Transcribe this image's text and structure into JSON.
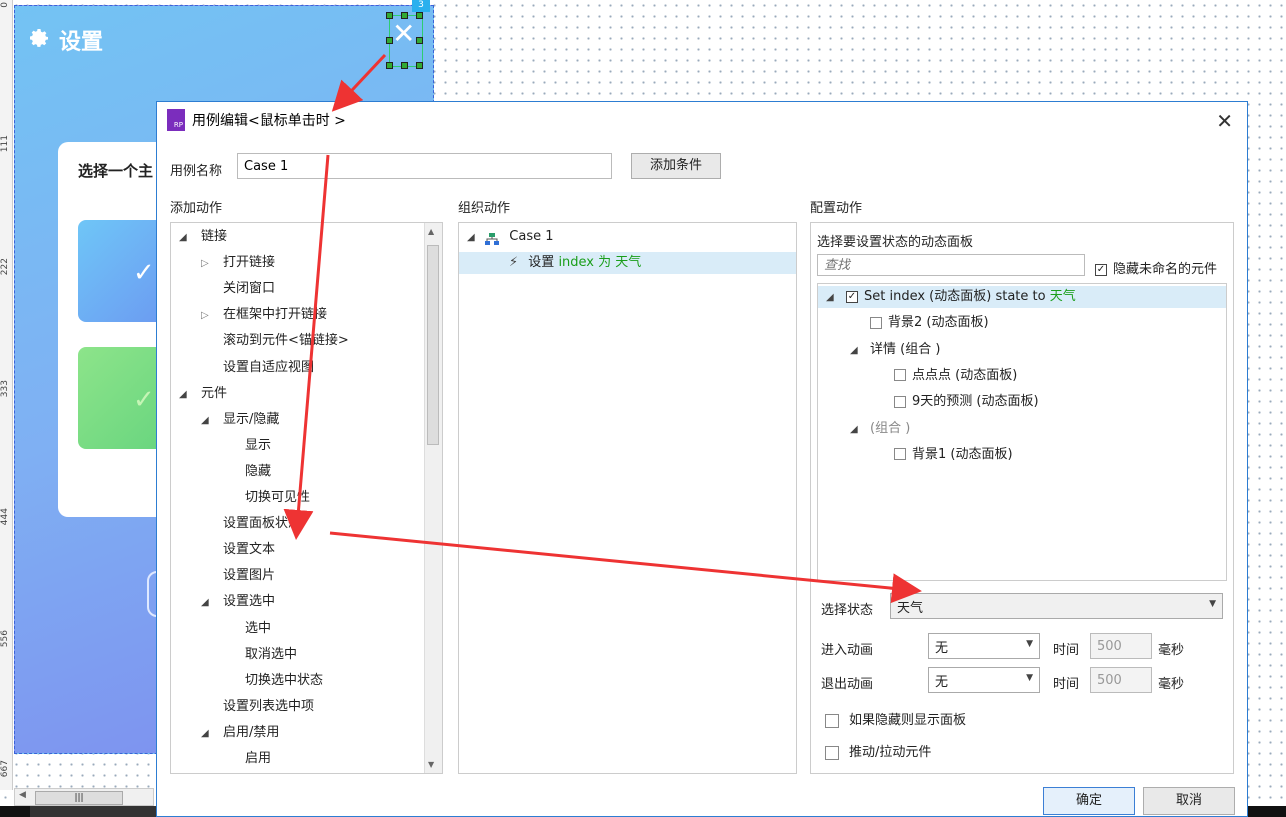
{
  "mockup": {
    "title": "设置",
    "card_title": "选择一个主",
    "badge": "3"
  },
  "ruler": [
    "0",
    "111",
    "222",
    "333",
    "444",
    "556",
    "667"
  ],
  "dialog": {
    "title": "用例编辑<鼠标单击时 >",
    "case_name_label": "用例名称",
    "case_name_value": "Case 1",
    "add_condition": "添加条件",
    "col_add": "添加动作",
    "col_org": "组织动作",
    "col_config": "配置动作",
    "add_actions": [
      {
        "label": "链接",
        "level": 0,
        "exp": "open"
      },
      {
        "label": "打开链接",
        "level": 1,
        "exp": "closed"
      },
      {
        "label": "关闭窗口",
        "level": 1,
        "exp": "none"
      },
      {
        "label": "在框架中打开链接",
        "level": 1,
        "exp": "closed"
      },
      {
        "label": "滚动到元件<锚链接>",
        "level": 1,
        "exp": "none"
      },
      {
        "label": "设置自适应视图",
        "level": 1,
        "exp": "none"
      },
      {
        "label": "元件",
        "level": 0,
        "exp": "open"
      },
      {
        "label": "显示/隐藏",
        "level": 1,
        "exp": "open"
      },
      {
        "label": "显示",
        "level": 2,
        "exp": "none"
      },
      {
        "label": "隐藏",
        "level": 2,
        "exp": "none"
      },
      {
        "label": "切换可见性",
        "level": 2,
        "exp": "none"
      },
      {
        "label": "设置面板状态",
        "level": 1,
        "exp": "none"
      },
      {
        "label": "设置文本",
        "level": 1,
        "exp": "none"
      },
      {
        "label": "设置图片",
        "level": 1,
        "exp": "none"
      },
      {
        "label": "设置选中",
        "level": 1,
        "exp": "open"
      },
      {
        "label": "选中",
        "level": 2,
        "exp": "none"
      },
      {
        "label": "取消选中",
        "level": 2,
        "exp": "none"
      },
      {
        "label": "切换选中状态",
        "level": 2,
        "exp": "none"
      },
      {
        "label": "设置列表选中项",
        "level": 1,
        "exp": "none"
      },
      {
        "label": "启用/禁用",
        "level": 1,
        "exp": "open"
      },
      {
        "label": "启用",
        "level": 2,
        "exp": "none"
      }
    ],
    "org": {
      "case": "Case 1",
      "action_prefix": "设置",
      "action_target": "index 为 天气"
    },
    "config": {
      "panel_title": "选择要设置状态的动态面板",
      "search_placeholder": "查找",
      "hide_unnamed": "隐藏未命名的元件",
      "tree": [
        {
          "pre": "Set index (动态面板) state to ",
          "hl": "天气",
          "checked": true,
          "tri": true,
          "indent": 0
        },
        {
          "pre": "背景2 (动态面板)",
          "hl": "",
          "checked": false,
          "tri": false,
          "indent": 1
        },
        {
          "pre": "详情 (组合 )",
          "hl": "",
          "checked": null,
          "tri": true,
          "indent": 1
        },
        {
          "pre": "点点点 (动态面板)",
          "hl": "",
          "checked": false,
          "tri": false,
          "indent": 2
        },
        {
          "pre": "9天的预测 (动态面板)",
          "hl": "",
          "checked": false,
          "tri": false,
          "indent": 2
        },
        {
          "pre": "(组合 )",
          "hl": "",
          "checked": null,
          "tri": true,
          "indent": 1,
          "gray": true
        },
        {
          "pre": "背景1 (动态面板)",
          "hl": "",
          "checked": false,
          "tri": false,
          "indent": 2
        }
      ],
      "select_state_label": "选择状态",
      "select_state_value": "天气",
      "enter_anim_label": "进入动画",
      "enter_anim_value": "无",
      "exit_anim_label": "退出动画",
      "exit_anim_value": "无",
      "time_label": "时间",
      "time_value": "500",
      "ms_label": "毫秒",
      "show_if_hidden": "如果隐藏则显示面板",
      "push_pull": "推动/拉动元件"
    },
    "ok": "确定",
    "cancel": "取消"
  }
}
